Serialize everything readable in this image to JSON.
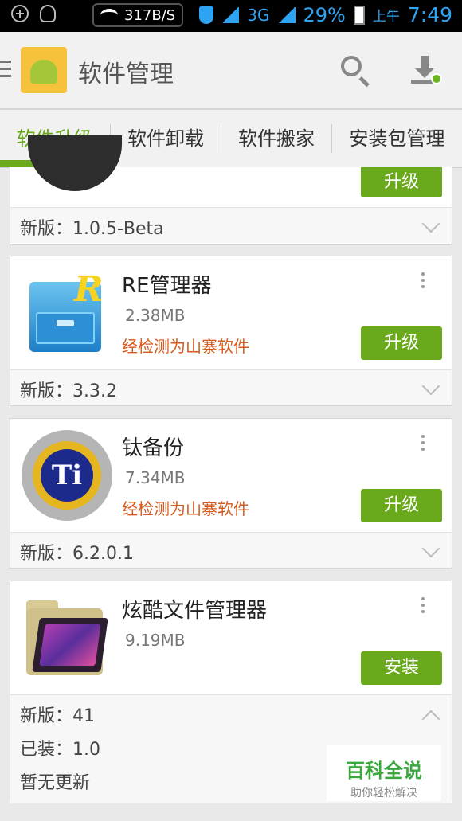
{
  "status_bar": {
    "speed": "317B/S",
    "network": "3G",
    "battery": "29%",
    "ampm": "上午",
    "time": "7:49"
  },
  "app_bar": {
    "title": "软件管理"
  },
  "tabs": [
    {
      "label": "软件升级",
      "active": true
    },
    {
      "label": "软件卸载",
      "active": false
    },
    {
      "label": "软件搬家",
      "active": false
    },
    {
      "label": "安装包管理",
      "active": false
    }
  ],
  "partial_item": {
    "button": "升级",
    "new_version": "新版：1.0.5-Beta"
  },
  "apps": [
    {
      "name": "RE管理器",
      "size": "2.38MB",
      "warning": "经检测为山寨软件",
      "button": "升级",
      "new_version": "新版：3.3.2"
    },
    {
      "name": "钛备份",
      "size": "7.34MB",
      "warning": "经检测为山寨软件",
      "button": "升级",
      "new_version": "新版：6.2.0.1"
    },
    {
      "name": "炫酷文件管理器",
      "size": "9.19MB",
      "button": "安装",
      "new_version": "新版：41",
      "installed": "已装：1.0",
      "note": "暂无更新"
    }
  ],
  "watermark": {
    "title": "百科全说",
    "subtitle": "助你轻松解决"
  },
  "colors": {
    "accent": "#6aa81c",
    "warning": "#d45a1d",
    "status_blue": "#2ea3f2"
  }
}
